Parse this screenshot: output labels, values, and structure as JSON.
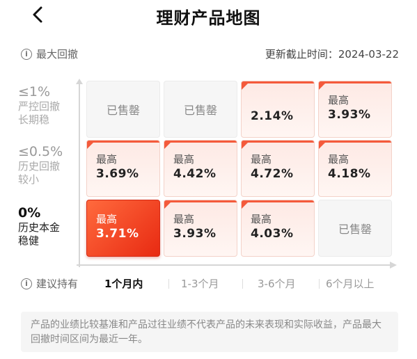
{
  "header": {
    "title": "理财产品地图"
  },
  "meta": {
    "drawdown_label": "最大回撤",
    "update_label": "更新截止时间：2024-03-22"
  },
  "y_axis": [
    {
      "pct": "≤1%",
      "desc_line1": "严控回撤",
      "desc_line2": "长期稳"
    },
    {
      "pct": "≤0.5%",
      "desc_line1": "历史回撤",
      "desc_line2": "较小"
    },
    {
      "pct": "0%",
      "desc_line1": "历史本金",
      "desc_line2": "稳健"
    }
  ],
  "grid": [
    [
      {
        "status": "sold",
        "text": "已售罄"
      },
      {
        "status": "sold",
        "text": "已售罄"
      },
      {
        "status": "warm",
        "label": "",
        "rate": "2.14%"
      },
      {
        "status": "warm",
        "label": "最高",
        "rate": "3.93%"
      }
    ],
    [
      {
        "status": "warm",
        "label": "最高",
        "rate": "3.69%"
      },
      {
        "status": "warm",
        "label": "最高",
        "rate": "4.42%"
      },
      {
        "status": "warm",
        "label": "最高",
        "rate": "4.72%"
      },
      {
        "status": "warm",
        "label": "最高",
        "rate": "4.18%"
      }
    ],
    [
      {
        "status": "hot",
        "label": "最高",
        "rate": "3.71%"
      },
      {
        "status": "warm",
        "label": "最高",
        "rate": "3.93%"
      },
      {
        "status": "warm",
        "label": "最高",
        "rate": "4.03%"
      },
      {
        "status": "sold",
        "text": "已售罄"
      }
    ]
  ],
  "holding": {
    "label": "建议持有",
    "options": [
      "1个月内",
      "1-3个月",
      "3-6个月",
      "6个月以上"
    ],
    "selected": "1个月内"
  },
  "disclaimer": "产品的业绩比较基准和产品过往业绩不代表产品的未来表现和实际收益，产品最大回撤时间区间为最近一年。",
  "colors": {
    "accent": "#f45a3b",
    "hot_start": "#ff6a3d",
    "hot_end": "#e82a12"
  }
}
